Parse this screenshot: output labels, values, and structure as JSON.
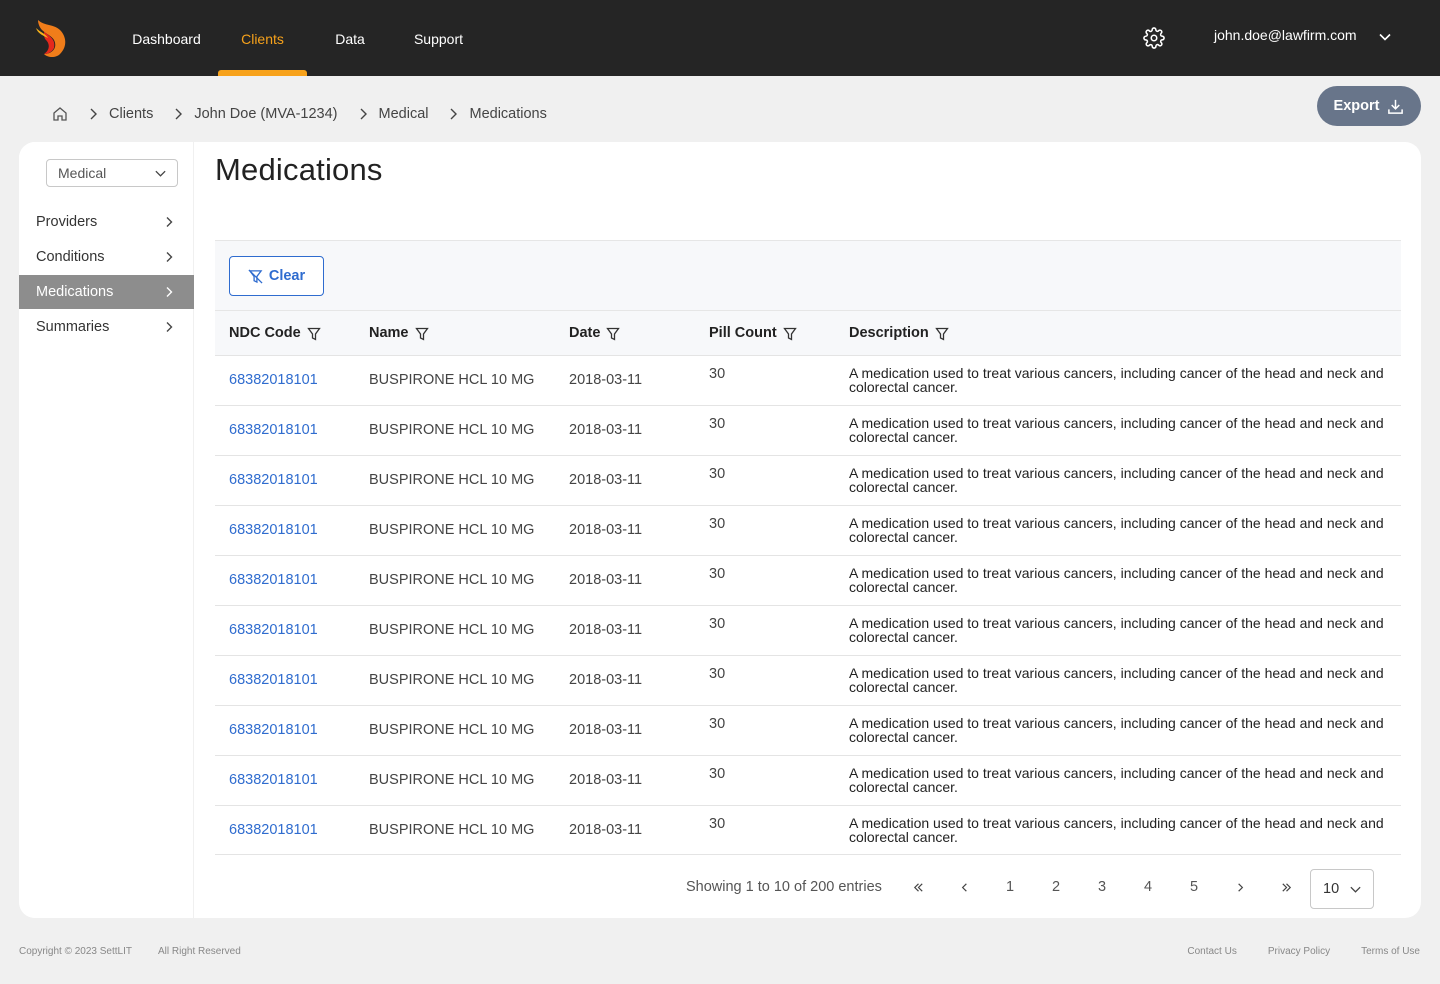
{
  "nav": {
    "items": [
      "Dashboard",
      "Clients",
      "Data",
      "Support"
    ],
    "active": "Clients",
    "user_email": "john.doe@lawfirm.com"
  },
  "breadcrumb": [
    "Clients",
    "John Doe (MVA-1234)",
    "Medical",
    "Medications"
  ],
  "export_label": "Export",
  "sidebar": {
    "category_select": "Medical",
    "items": [
      {
        "label": "Providers"
      },
      {
        "label": "Conditions"
      },
      {
        "label": "Medications",
        "active": true
      },
      {
        "label": "Summaries"
      }
    ]
  },
  "page_title": "Medications",
  "table": {
    "clear_label": "Clear",
    "columns": [
      "NDC Code",
      "Name",
      "Date",
      "Pill Count",
      "Description"
    ],
    "rows": [
      {
        "ndc": "68382018101",
        "name": "BUSPIRONE HCL 10 MG",
        "date": "2018-03-11",
        "pill": "30",
        "desc": "A medication used to treat various cancers, including cancer of the head and neck and colorectal cancer."
      },
      {
        "ndc": "68382018101",
        "name": "BUSPIRONE HCL 10 MG",
        "date": "2018-03-11",
        "pill": "30",
        "desc": "A medication used to treat various cancers, including cancer of the head and neck and colorectal cancer."
      },
      {
        "ndc": "68382018101",
        "name": "BUSPIRONE HCL 10 MG",
        "date": "2018-03-11",
        "pill": "30",
        "desc": "A medication used to treat various cancers, including cancer of the head and neck and colorectal cancer."
      },
      {
        "ndc": "68382018101",
        "name": "BUSPIRONE HCL 10 MG",
        "date": "2018-03-11",
        "pill": "30",
        "desc": "A medication used to treat various cancers, including cancer of the head and neck and colorectal cancer."
      },
      {
        "ndc": "68382018101",
        "name": "BUSPIRONE HCL 10 MG",
        "date": "2018-03-11",
        "pill": "30",
        "desc": "A medication used to treat various cancers, including cancer of the head and neck and colorectal cancer."
      },
      {
        "ndc": "68382018101",
        "name": "BUSPIRONE HCL 10 MG",
        "date": "2018-03-11",
        "pill": "30",
        "desc": "A medication used to treat various cancers, including cancer of the head and neck and colorectal cancer."
      },
      {
        "ndc": "68382018101",
        "name": "BUSPIRONE HCL 10 MG",
        "date": "2018-03-11",
        "pill": "30",
        "desc": "A medication used to treat various cancers, including cancer of the head and neck and colorectal cancer."
      },
      {
        "ndc": "68382018101",
        "name": "BUSPIRONE HCL 10 MG",
        "date": "2018-03-11",
        "pill": "30",
        "desc": "A medication used to treat various cancers, including cancer of the head and neck and colorectal cancer."
      },
      {
        "ndc": "68382018101",
        "name": "BUSPIRONE HCL 10 MG",
        "date": "2018-03-11",
        "pill": "30",
        "desc": "A medication used to treat various cancers, including cancer of the head and neck and colorectal cancer."
      },
      {
        "ndc": "68382018101",
        "name": "BUSPIRONE HCL 10 MG",
        "date": "2018-03-11",
        "pill": "30",
        "desc": "A medication used to treat various cancers, including cancer of the head and neck and colorectal cancer."
      }
    ]
  },
  "pagination": {
    "info": "Showing 1 to 10 of 200 entries",
    "pages": [
      "1",
      "2",
      "3",
      "4",
      "5"
    ],
    "page_size": "10"
  },
  "footer": {
    "copyright": "Copyright © 2023 SettLIT",
    "rights": "All Right Reserved",
    "links": [
      "Contact Us",
      "Privacy Policy",
      "Terms of Use"
    ]
  },
  "colors": {
    "topbar": "#252525",
    "accent": "#f7a21b",
    "link": "#2f6ccf",
    "export_button": "#68758a",
    "sidebar_active": "#8d8d8d"
  }
}
